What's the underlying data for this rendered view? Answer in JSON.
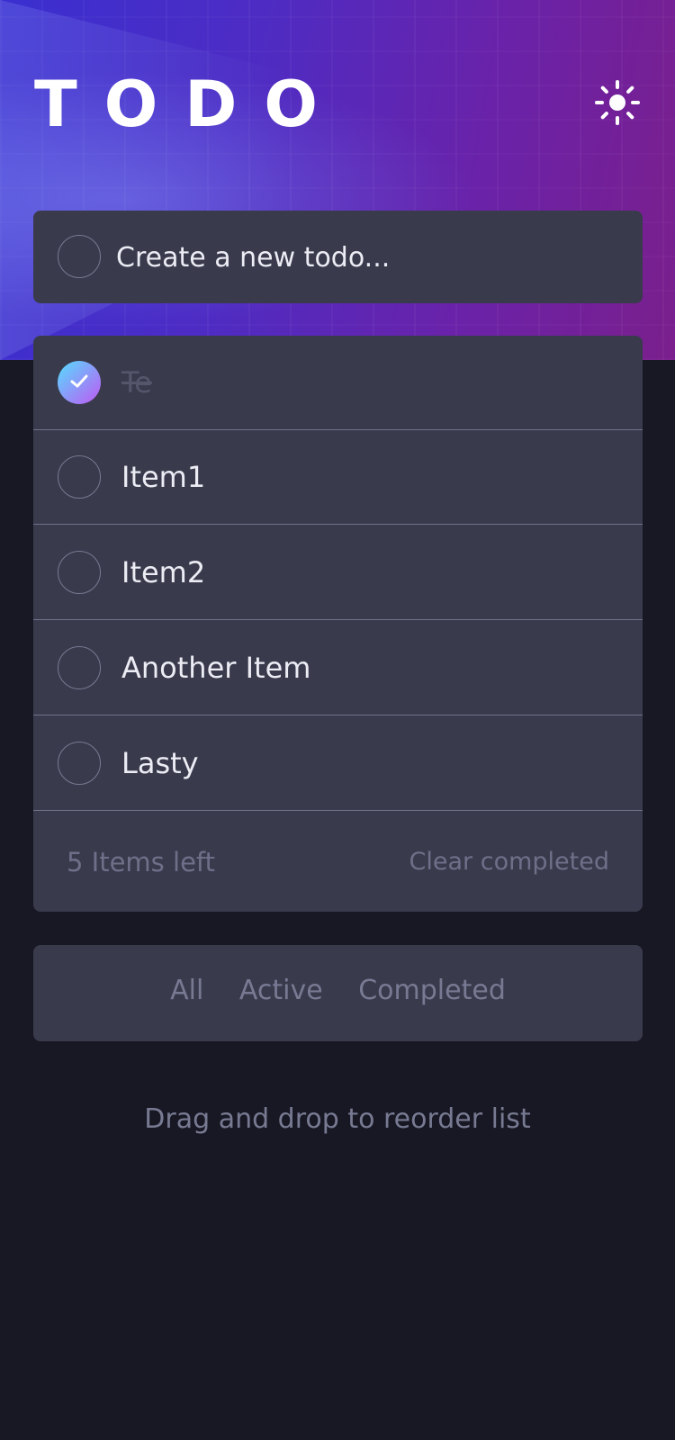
{
  "header": {
    "title": "TODO",
    "theme_icon": "sun-icon"
  },
  "new_todo": {
    "placeholder": "Create a new todo..."
  },
  "todos": [
    {
      "text": "Te",
      "completed": true
    },
    {
      "text": "Item1",
      "completed": false
    },
    {
      "text": "Item2",
      "completed": false
    },
    {
      "text": "Another Item",
      "completed": false
    },
    {
      "text": "Lasty",
      "completed": false
    }
  ],
  "footer": {
    "items_left": "5 Items left",
    "clear_completed": "Clear completed"
  },
  "filters": {
    "all": "All",
    "active": "Active",
    "completed": "Completed"
  },
  "hint": "Drag and drop to reorder list",
  "colors": {
    "background": "#181824",
    "card": "#393a4c",
    "check_gradient_start": "#55ddff",
    "check_gradient_end": "#c058f3",
    "muted_text": "#777a92"
  }
}
